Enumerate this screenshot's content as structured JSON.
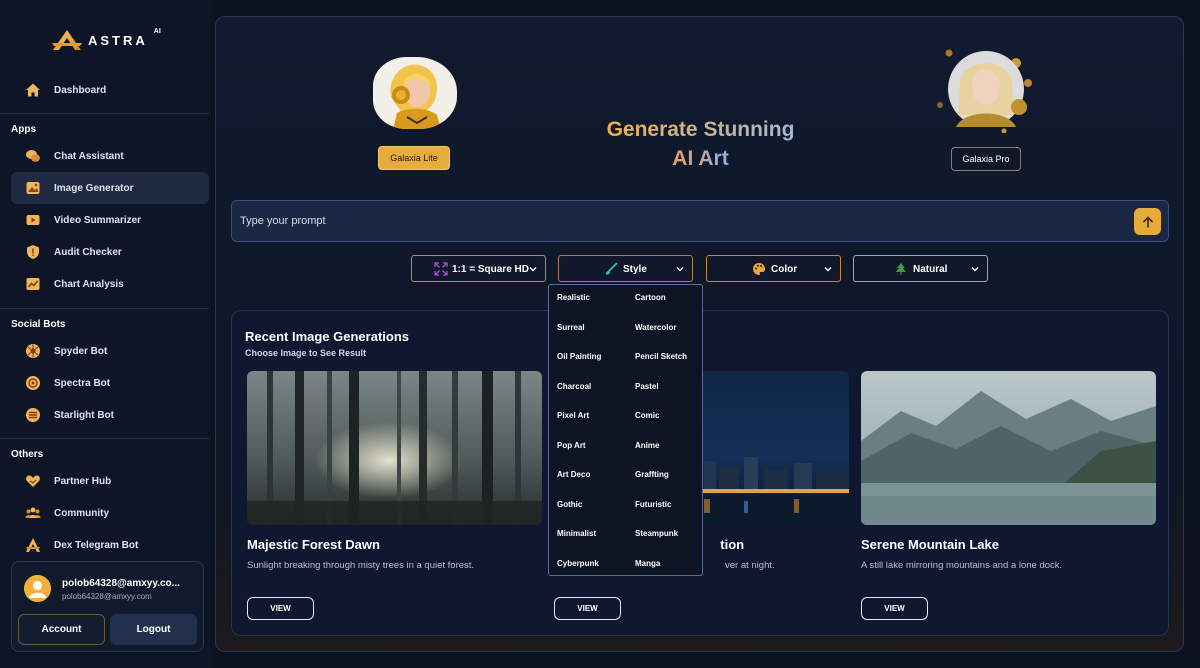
{
  "brand": {
    "name": "ASTRA",
    "suffix": "AI",
    "accent": "#E7AB3A"
  },
  "sidebar": {
    "dashboard": {
      "label": "Dashboard",
      "icon": "home-icon"
    },
    "sections": [
      {
        "title": "Apps",
        "items": [
          {
            "label": "Chat Assistant",
            "icon": "chat-icon"
          },
          {
            "label": "Image Generator",
            "icon": "image-icon",
            "active": true
          },
          {
            "label": "Video Summarizer",
            "icon": "video-icon"
          },
          {
            "label": "Audit Checker",
            "icon": "shield-icon"
          },
          {
            "label": "Chart Analysis",
            "icon": "chart-icon"
          }
        ]
      },
      {
        "title": "Social Bots",
        "items": [
          {
            "label": "Spyder Bot",
            "icon": "spider-icon"
          },
          {
            "label": "Spectra Bot",
            "icon": "spectra-icon"
          },
          {
            "label": "Starlight Bot",
            "icon": "starlight-icon"
          }
        ]
      },
      {
        "title": "Others",
        "items": [
          {
            "label": "Partner Hub",
            "icon": "heart-handshake-icon"
          },
          {
            "label": "Community",
            "icon": "community-icon"
          },
          {
            "label": "Dex Telegram Bot",
            "icon": "astra-logo-icon"
          }
        ]
      }
    ],
    "user": {
      "name": "polob64328@amxyy.co...",
      "email": "polob64328@amxyy.com",
      "account_label": "Account",
      "logout_label": "Logout"
    }
  },
  "main": {
    "models": {
      "lite": "Galaxia Lite",
      "pro": "Galaxia Pro",
      "selected": "lite"
    },
    "hero": {
      "line1": "Generate Stunning",
      "line2": "AI Art"
    },
    "prompt": {
      "placeholder": "Type your prompt",
      "value": ""
    },
    "selects": [
      {
        "label": "1:1 = Square HD",
        "icon": "expand-icon"
      },
      {
        "label": "Style",
        "icon": "brush-icon"
      },
      {
        "label": "Color",
        "icon": "palette-icon"
      },
      {
        "label": "Natural",
        "icon": "tree-icon"
      }
    ],
    "style_options": [
      [
        "Realistic",
        "Cartoon"
      ],
      [
        "Surreal",
        "Watercolor"
      ],
      [
        "Oil Painting",
        "Pencil Sketch"
      ],
      [
        "Charcoal",
        "Pastel"
      ],
      [
        "Pixel Art",
        "Comic"
      ],
      [
        "Pop Art",
        "Anime"
      ],
      [
        "Art Deco",
        "Graffting"
      ],
      [
        "Gothic",
        "Futuristic"
      ],
      [
        "Minimalist",
        "Steampunk"
      ],
      [
        "Cyberpunk",
        "Manga"
      ]
    ],
    "recent": {
      "title": "Recent Image Generations",
      "subtitle": "Choose Image to See Result",
      "cards": [
        {
          "title": "Majestic Forest Dawn",
          "desc": "Sunlight breaking through misty trees in a quiet forest.",
          "button": "VIEW"
        },
        {
          "title": "tion",
          "desc": "ver at night.",
          "button": "VIEW"
        },
        {
          "title": "Serene Mountain Lake",
          "desc": "A still lake mirroring mountains and a lone dock.",
          "button": "VIEW"
        }
      ]
    }
  }
}
